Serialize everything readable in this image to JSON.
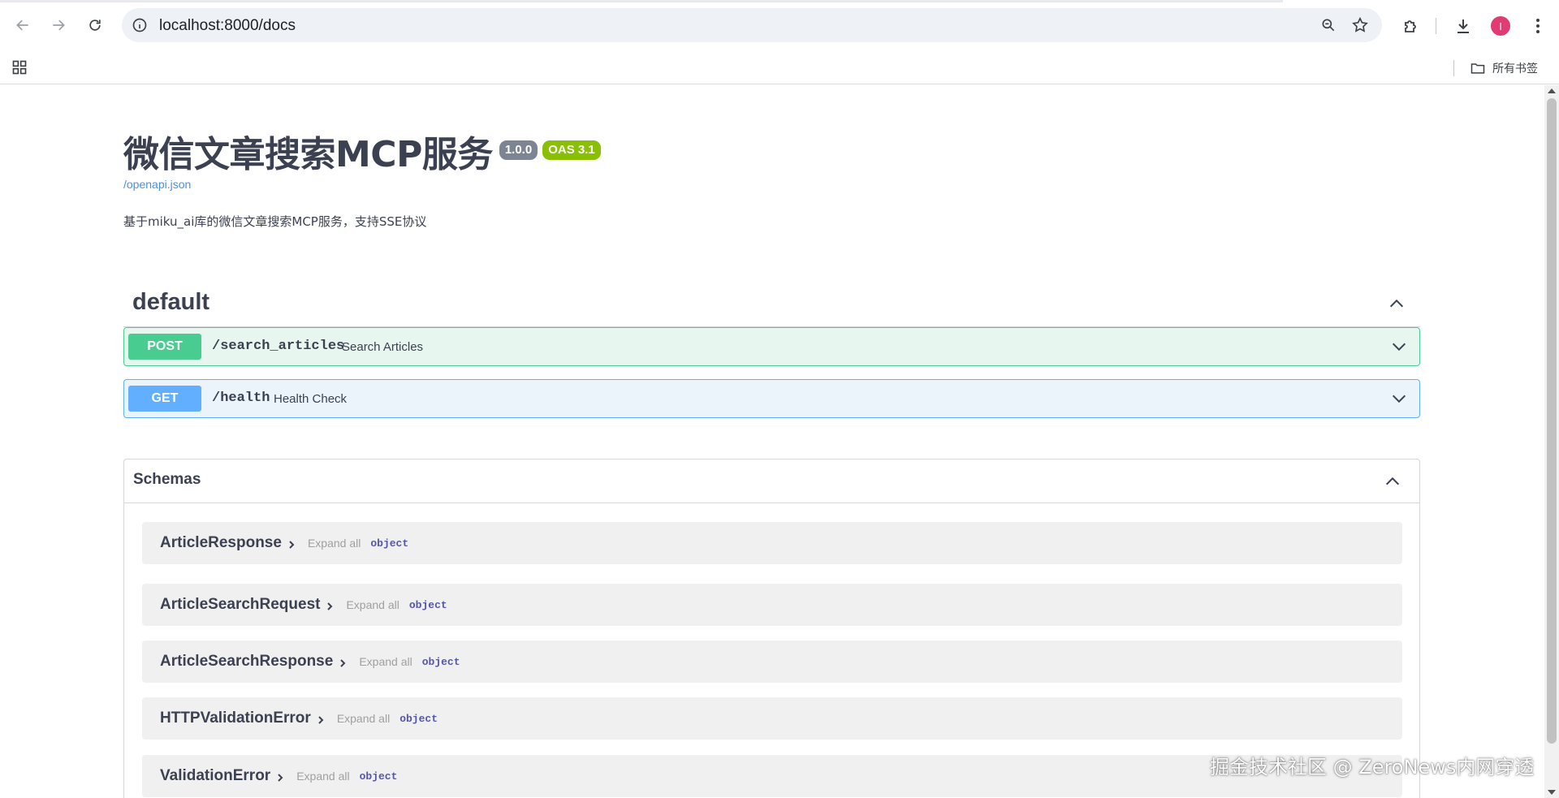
{
  "browser": {
    "url": "localhost:8000/docs",
    "avatar_letter": "I",
    "bookmarks_folder": "所有书签",
    "icons": [
      "back-icon",
      "forward-icon",
      "reload-icon",
      "site-info-icon",
      "zoom-icon",
      "bookmark-star-icon",
      "extensions-icon",
      "download-icon",
      "menu-icon",
      "apps-icon",
      "folder-icon"
    ]
  },
  "info": {
    "title": "微信文章搜索MCP服务",
    "version": "1.0.0",
    "oas": "OAS 3.1",
    "spec_link": "/openapi.json",
    "description": "基于miku_ai库的微信文章搜索MCP服务，支持SSE协议"
  },
  "tag": {
    "name": "default",
    "operations": [
      {
        "method": "POST",
        "path": "/search_articles",
        "summary": "Search Articles"
      },
      {
        "method": "GET",
        "path": "/health",
        "summary": "Health Check"
      }
    ]
  },
  "schemas": {
    "title": "Schemas",
    "models": [
      {
        "name": "ArticleResponse",
        "expand": "Expand all",
        "type": "object"
      },
      {
        "name": "ArticleSearchRequest",
        "expand": "Expand all",
        "type": "object"
      },
      {
        "name": "ArticleSearchResponse",
        "expand": "Expand all",
        "type": "object"
      },
      {
        "name": "HTTPValidationError",
        "expand": "Expand all",
        "type": "object"
      },
      {
        "name": "ValidationError",
        "expand": "Expand all",
        "type": "object"
      }
    ]
  },
  "watermark": "掘金技术社区 @ ZeroNews内网穿透",
  "colors": {
    "post": "#49cc90",
    "get": "#61affe",
    "version_badge": "#7d8492",
    "oas_badge": "#89bf04",
    "link": "#4990e2"
  }
}
